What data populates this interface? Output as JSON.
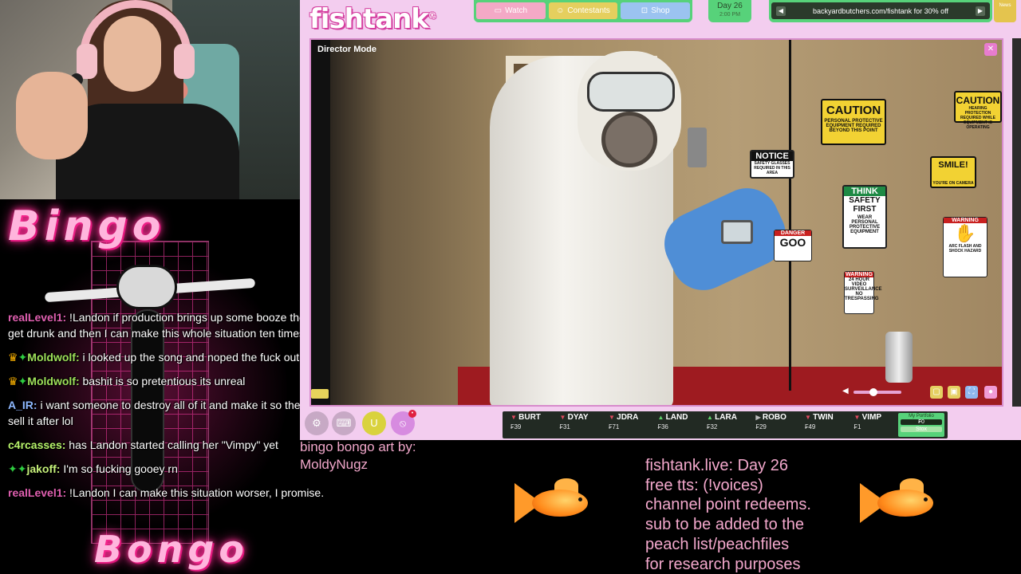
{
  "overlay": {
    "bingo_title": "Bingo",
    "bongo_title": "Bongo",
    "art_credit_line1": "bingo bongo art by:",
    "art_credit_line2": "MoldyNugz",
    "info_lines": [
      "fishtank.live: Day 26",
      "free tts: (!voices)",
      "channel point redeems.",
      "sub to be added to the",
      "peach list/peachfiles",
      "for research purposes"
    ]
  },
  "chat": [
    {
      "user": "realLevel1:",
      "text": " !Landon if production brings up some booze then I can get drunk and then I can make this whole situation ten times worser",
      "color": "#e05fb0",
      "badges": ""
    },
    {
      "user": "Moldwolf:",
      "text": " i looked up the song and noped the fuck out",
      "color": "#9fe05a",
      "badges": "crown-gem"
    },
    {
      "user": "Moldwolf:",
      "text": " bashit is so pretentious its unreal",
      "color": "#9fe05a",
      "badges": "crown-gem"
    },
    {
      "user": "A_IR:",
      "text": " i want someone to destroy all of it and make it so they cant sell it after lol",
      "color": "#8fb8ff",
      "badges": ""
    },
    {
      "user": "c4rcasses:",
      "text": " has Landon started calling her \"Vimpy\" yet",
      "color": "#b6f26a",
      "badges": ""
    },
    {
      "user": "jakoff:",
      "text": " I'm so fucking gooey rn",
      "color": "#c6f07a",
      "badges": "gem-gem"
    },
    {
      "user": "realLevel1:",
      "text": " !Landon I can make this situation worser, I promise.",
      "color": "#e05fb0",
      "badges": ""
    }
  ],
  "site": {
    "logo": "fishtank",
    "nav": {
      "watch": "Watch",
      "contestants": "Contestants",
      "shop": "Shop"
    },
    "day": {
      "label": "Day 26",
      "time": "2:00 PM"
    },
    "promo": "backyardbutchers.com/fishtank for 30% off",
    "corner_tab": "News",
    "player_title": "Director Mode",
    "signs": {
      "caution1": "CAUTION",
      "caution1_small": "PERSONAL PROTECTIVE EQUIPMENT REQUIRED BEYOND THIS POINT",
      "caution2": "CAUTION",
      "caution2_small": "HEARING PROTECTION REQUIRED WHILE EQUIPMENT IS OPERATING",
      "smile": "SMILE!",
      "smile_small": "YOU'RE ON CAMERA",
      "notice": "NOTICE",
      "notice_small": "SAFETY GLASSES REQUIRED IN THIS AREA",
      "think": "THINK",
      "think_body": "SAFETY FIRST",
      "think_small": "WEAR PERSONAL PROTECTIVE EQUIPMENT",
      "danger_head": "DANGER",
      "danger_body": "GOO",
      "warning1_head": "WARNING",
      "warning1_body": "24 HOUR VIDEO SURVEILLANCE NO TRESPASSING",
      "warning2_head": "WARNING",
      "warning2_body": "ARC FLASH AND SHOCK HAZARD"
    },
    "ticker": [
      {
        "name": "BURT",
        "value": "39",
        "dir": "down"
      },
      {
        "name": "DYAY",
        "value": "31",
        "dir": "down"
      },
      {
        "name": "JDRA",
        "value": "71",
        "dir": "down"
      },
      {
        "name": "LAND",
        "value": "36",
        "dir": "up"
      },
      {
        "name": "LARA",
        "value": "32",
        "dir": "up"
      },
      {
        "name": "ROBO",
        "value": "29",
        "dir": "flat"
      },
      {
        "name": "TWIN",
        "value": "49",
        "dir": "down"
      },
      {
        "name": "VIMP",
        "value": "1",
        "dir": "down"
      }
    ],
    "portfolio": {
      "label": "My Portfolio",
      "value": "0",
      "button": "Stox"
    }
  },
  "colors": {
    "site_bg": "#f3cdef",
    "nav_green": "#57d27a",
    "bingo_pink": "#ff2d95",
    "overlay_text": "#f3a8cc"
  }
}
